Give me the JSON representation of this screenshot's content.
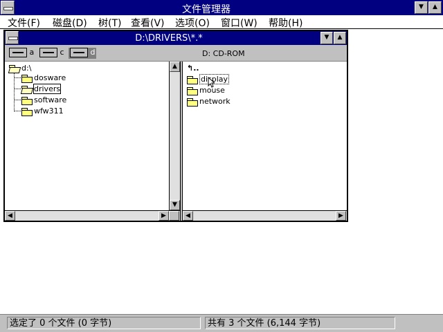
{
  "app": {
    "title": "文件管理器"
  },
  "menubar": [
    {
      "label": "文件(F)"
    },
    {
      "label": "磁盘(D)"
    },
    {
      "label": "树(T)"
    },
    {
      "label": "查看(V)"
    },
    {
      "label": "选项(O)"
    },
    {
      "label": "窗口(W)"
    },
    {
      "label": "帮助(H)"
    }
  ],
  "child": {
    "title": "D:\\DRIVERS\\*.*",
    "drives": [
      {
        "letter": "a"
      },
      {
        "letter": "c"
      },
      {
        "letter": "d"
      }
    ],
    "selected_drive": "d",
    "volume_label": "D: CD-ROM"
  },
  "tree": {
    "root": "d:\\",
    "children": [
      {
        "name": "dosware"
      },
      {
        "name": "drivers"
      },
      {
        "name": "software"
      },
      {
        "name": "wfw311"
      }
    ],
    "selected": "drivers"
  },
  "files": {
    "items": [
      {
        "name": "display"
      },
      {
        "name": "mouse"
      },
      {
        "name": "network"
      }
    ],
    "focused": "display"
  },
  "status": {
    "left": "选定了 0 个文件 (0 字节)",
    "right": "共有 3 个文件 (6,144 字节)"
  },
  "colors": {
    "title_bar": "#000080",
    "face": "#c0c0c0"
  }
}
